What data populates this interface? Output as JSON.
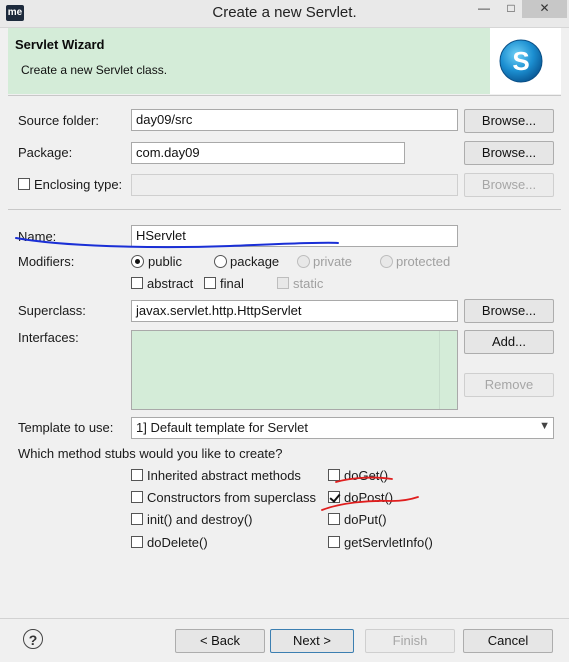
{
  "window": {
    "app_badge": "me",
    "title": "Create a new Servlet.",
    "minimize": "—",
    "maximize": "□",
    "close": "✕"
  },
  "banner": {
    "title": "Servlet Wizard",
    "description": "Create a new Servlet class.",
    "logo_letter": "S"
  },
  "form": {
    "source_folder": {
      "label": "Source folder:",
      "value": "day09/src",
      "button": "Browse..."
    },
    "package": {
      "label": "Package:",
      "value": "com.day09",
      "button": "Browse..."
    },
    "enclosing_type": {
      "label": "Enclosing type:",
      "checked": false,
      "value": "",
      "button": "Browse..."
    },
    "name": {
      "label": "Name:",
      "value": "HServlet"
    },
    "modifiers": {
      "label": "Modifiers:",
      "access": [
        "public",
        "package",
        "private",
        "protected"
      ],
      "selected": "public",
      "flags": [
        "abstract",
        "final",
        "static"
      ]
    },
    "superclass": {
      "label": "Superclass:",
      "value": "javax.servlet.http.HttpServlet",
      "button": "Browse..."
    },
    "interfaces": {
      "label": "Interfaces:",
      "add_button": "Add...",
      "remove_button": "Remove"
    },
    "template": {
      "label": "Template to use:",
      "selected": "1] Default template for Servlet"
    },
    "stubs": {
      "question": "Which method stubs would you like to create?",
      "items": [
        {
          "label": "Inherited abstract methods",
          "checked": false
        },
        {
          "label": "doGet()",
          "checked": false
        },
        {
          "label": "Constructors from superclass",
          "checked": false
        },
        {
          "label": "doPost()",
          "checked": true
        },
        {
          "label": "init() and destroy()",
          "checked": false
        },
        {
          "label": "doPut()",
          "checked": false
        },
        {
          "label": "doDelete()",
          "checked": false
        },
        {
          "label": "getServletInfo()",
          "checked": false
        }
      ]
    }
  },
  "footer": {
    "help": "?",
    "back": "< Back",
    "next": "Next >",
    "finish": "Finish",
    "cancel": "Cancel"
  },
  "colors": {
    "banner_bg": "#d4ecd8",
    "annotation_blue": "#1a2fd6",
    "annotation_red": "#e01e1e"
  }
}
